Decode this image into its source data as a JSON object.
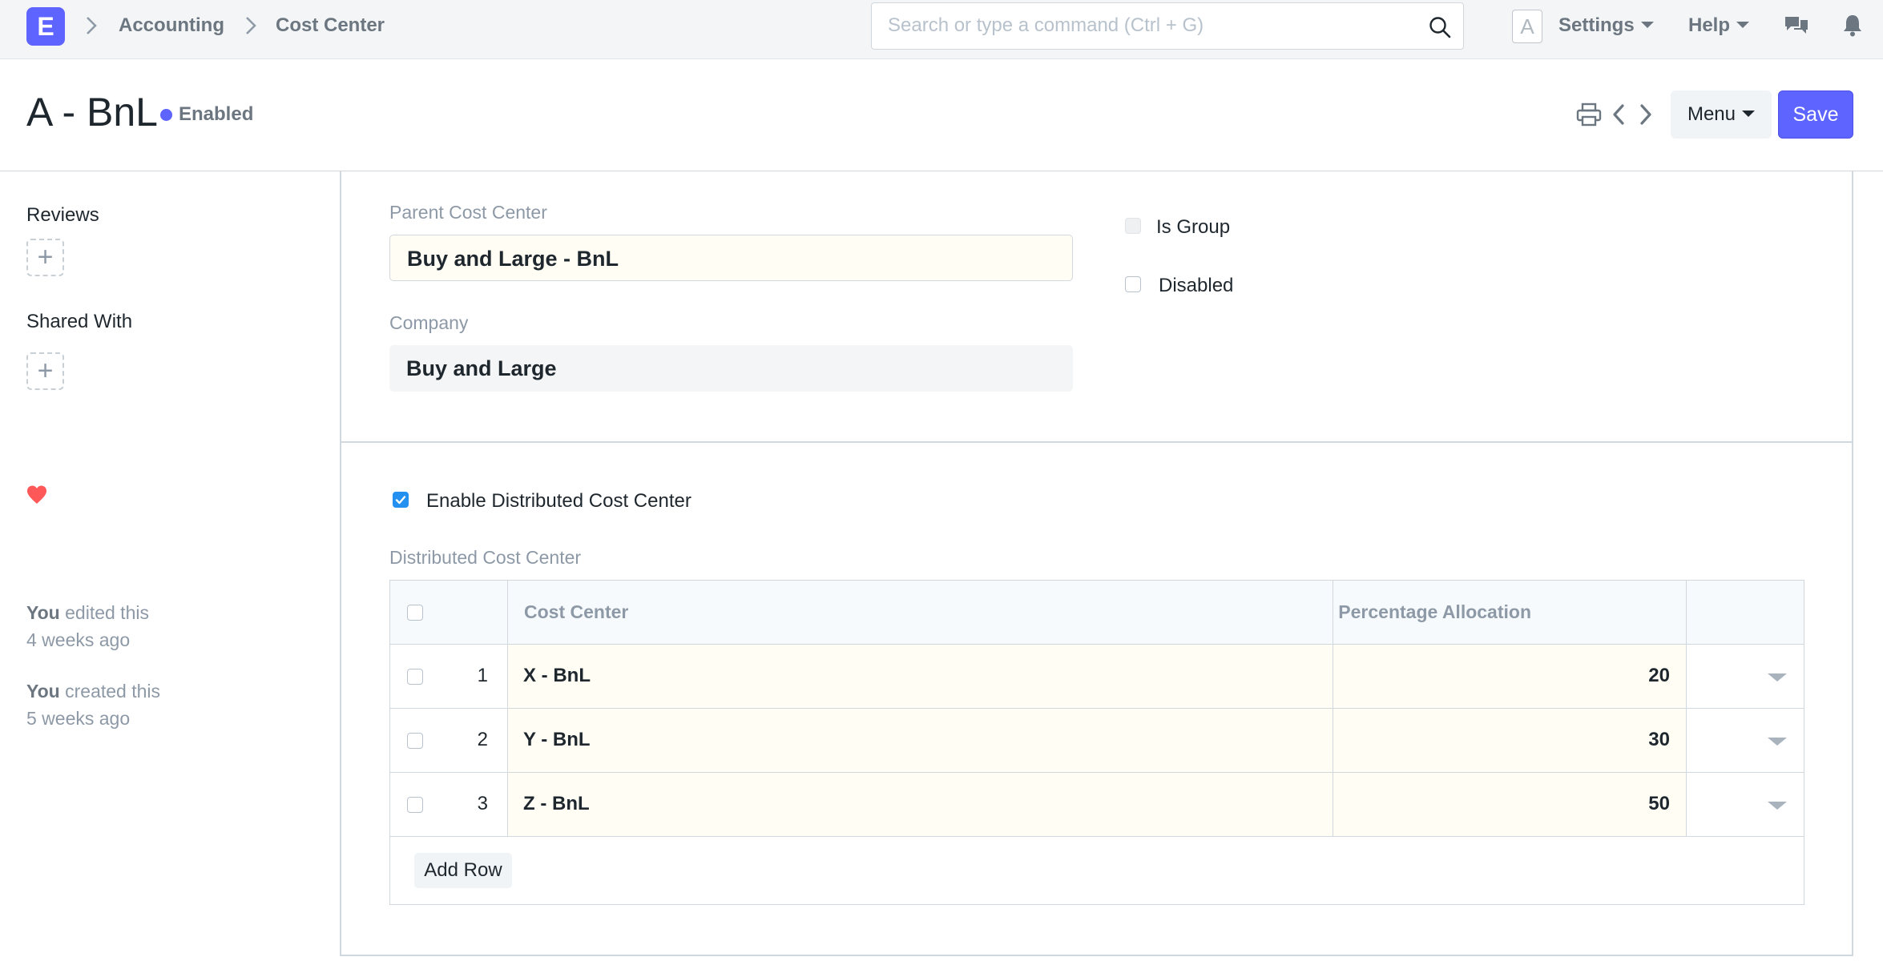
{
  "navbar": {
    "logo_letter": "E",
    "breadcrumbs": [
      "Accounting",
      "Cost Center"
    ],
    "search_placeholder": "Search or type a command (Ctrl + G)",
    "avatar_letter": "A",
    "settings_label": "Settings",
    "help_label": "Help"
  },
  "page": {
    "title": "A - BnL",
    "status": "Enabled",
    "menu_label": "Menu",
    "save_label": "Save"
  },
  "sidebar": {
    "reviews_label": "Reviews",
    "shared_with_label": "Shared With",
    "timeline": [
      {
        "actor": "You",
        "action": " edited this",
        "when": "4 weeks ago"
      },
      {
        "actor": "You",
        "action": " created this",
        "when": "5 weeks ago"
      }
    ]
  },
  "form": {
    "parent_cost_center_label": "Parent Cost Center",
    "parent_cost_center_value": "Buy and Large - BnL",
    "company_label": "Company",
    "company_value": "Buy and Large",
    "is_group_label": "Is Group",
    "disabled_label": "Disabled",
    "enable_distributed_label": "Enable Distributed Cost Center",
    "distributed_table_label": "Distributed Cost Center"
  },
  "table": {
    "columns": [
      "Cost Center",
      "Percentage Allocation"
    ],
    "rows": [
      {
        "idx": "1",
        "cost_center": "X - BnL",
        "percentage": "20"
      },
      {
        "idx": "2",
        "cost_center": "Y - BnL",
        "percentage": "30"
      },
      {
        "idx": "3",
        "cost_center": "Z - BnL",
        "percentage": "50"
      }
    ],
    "add_row_label": "Add Row"
  },
  "colors": {
    "primary": "#5e64ff",
    "checkbox_checked": "#2490ef",
    "heart": "#ff5858"
  }
}
